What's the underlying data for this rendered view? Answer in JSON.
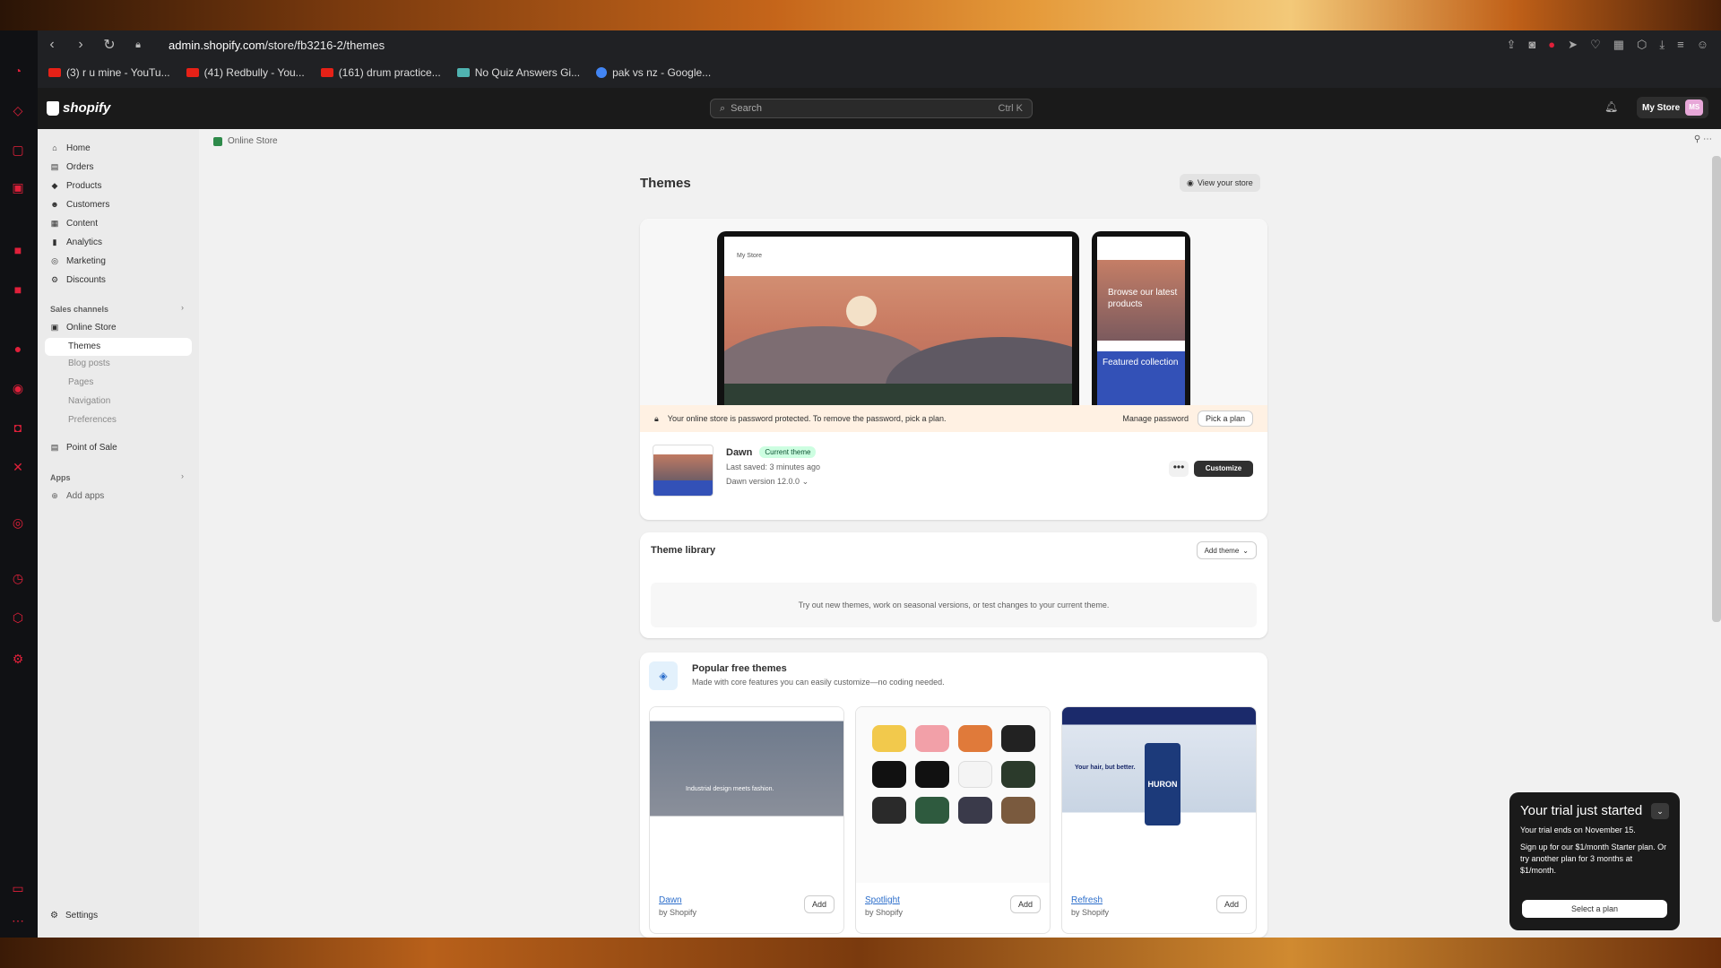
{
  "browser": {
    "url_host": "admin.shopify.com",
    "url_path": "/store/fb3216-2/themes",
    "bookmarks": [
      {
        "label": "(3) r u mine - YouTu...",
        "color": "#e62117"
      },
      {
        "label": "(41) Redbully - You...",
        "color": "#e62117"
      },
      {
        "label": "(161) drum practice...",
        "color": "#e62117"
      },
      {
        "label": "No Quiz Answers Gi...",
        "color": "#4fb3b1"
      },
      {
        "label": "pak vs nz - Google...",
        "color": "#4285f4"
      }
    ]
  },
  "topbar": {
    "logo": "shopify",
    "search_placeholder": "Search",
    "search_shortcut": "Ctrl K",
    "store_label": "My Store",
    "store_initials": "MS"
  },
  "nav": {
    "items": [
      "Home",
      "Orders",
      "Products",
      "Customers",
      "Content",
      "Analytics",
      "Marketing",
      "Discounts"
    ],
    "sales_channels_label": "Sales channels",
    "online_store": "Online Store",
    "sub_items": [
      "Themes",
      "Blog posts",
      "Pages",
      "Navigation",
      "Preferences"
    ],
    "point_of_sale": "Point of Sale",
    "apps_label": "Apps",
    "add_apps": "Add apps",
    "settings": "Settings"
  },
  "breadcrumb": "Online Store",
  "page": {
    "title": "Themes",
    "view_store": "View your store"
  },
  "preview": {
    "laptop_store": "My Store",
    "phone_text": "Browse our latest products",
    "phone_featured": "Featured collection"
  },
  "banner": {
    "text": "Your online store is password protected. To remove the password, pick a plan.",
    "manage": "Manage password",
    "pick": "Pick a plan"
  },
  "current_theme": {
    "name": "Dawn",
    "badge": "Current theme",
    "saved": "Last saved: 3 minutes ago",
    "version": "Dawn version 12.0.0",
    "more": "•••",
    "customize": "Customize"
  },
  "library": {
    "title": "Theme library",
    "add_theme": "Add theme",
    "empty": "Try out new themes, work on seasonal versions, or test changes to your current theme."
  },
  "popular": {
    "title": "Popular free themes",
    "subtitle": "Made with core features you can easily customize—no coding needed.",
    "themes": [
      {
        "name": "Dawn",
        "by": "by Shopify",
        "add": "Add"
      },
      {
        "name": "Spotlight",
        "by": "by Shopify",
        "add": "Add"
      },
      {
        "name": "Refresh",
        "by": "by Shopify",
        "add": "Add"
      }
    ],
    "dawn_overlay": "Industrial design meets fashion.",
    "refresh_text": "Your hair, but better.",
    "refresh_brand": "HURON"
  },
  "toast": {
    "title": "Your trial just started",
    "ends": "Your trial ends on November 15.",
    "body": "Sign up for our $1/month Starter plan. Or try another plan for 3 months at $1/month.",
    "select": "Select a plan"
  },
  "colors": {
    "accent": "#303030",
    "badge_bg": "#cdfee1",
    "banner_bg": "#fff1e3",
    "link": "#2c6ecb"
  }
}
